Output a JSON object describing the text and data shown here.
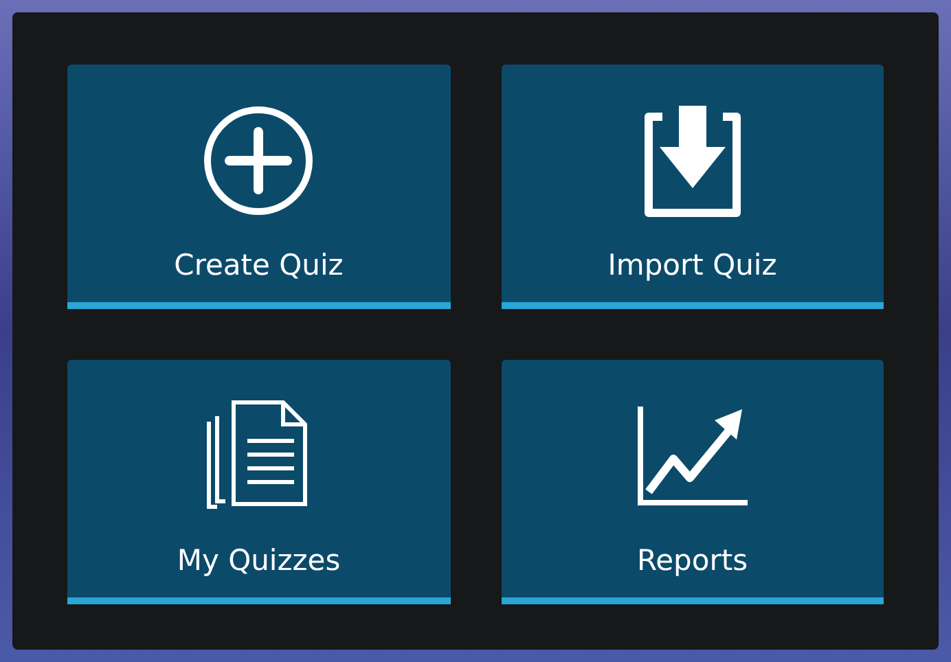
{
  "tiles": [
    {
      "label": "Create Quiz",
      "kind": "create"
    },
    {
      "label": "Import Quiz",
      "kind": "import"
    },
    {
      "label": "My Quizzes",
      "kind": "documents"
    },
    {
      "label": "Reports",
      "kind": "chart"
    }
  ]
}
